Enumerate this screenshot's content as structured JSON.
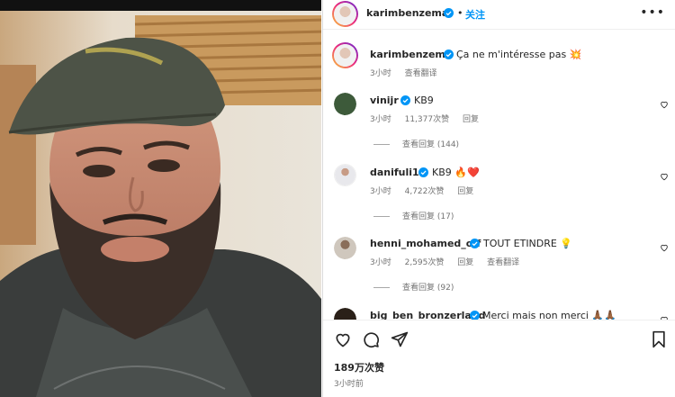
{
  "post": {
    "author": "karimbenzema",
    "follow_label": "关注",
    "more_icon": "more-horizontal-icon",
    "caption_text": "Ça ne m'intéresse pas 💥",
    "caption_time": "3小时",
    "caption_translate": "查看翻译",
    "likes": "189万次赞",
    "time": "3小时前"
  },
  "comments": [
    {
      "user": "vinijr",
      "verified": true,
      "text": "KB9",
      "time": "3小时",
      "likes": "11,377次赞",
      "reply": "回复",
      "replies": "查看回复 (144)",
      "avatar_color": "#3d5a3a"
    },
    {
      "user": "danifuli10",
      "verified": true,
      "text": "KB9 🔥❤️",
      "time": "3小时",
      "likes": "4,722次赞",
      "reply": "回复",
      "replies": "查看回复 (17)",
      "avatar_color": "#e8e8ec"
    },
    {
      "user": "henni_mohamed_off",
      "verified": true,
      "text": "TOUT ETINDRE 💡",
      "time": "3小时",
      "likes": "2,595次赞",
      "reply": "回复",
      "translate": "查看翻译",
      "replies": "查看回复 (92)",
      "avatar_color": "#6b5b4a"
    },
    {
      "user": "big_ben_bronzerland",
      "verified": true,
      "text": "Merci mais non merci 🙏🏾🙏🏾",
      "avatar_color": "#2a2018"
    }
  ],
  "colors": {
    "accent": "#0095f6",
    "verified": "#0095f6",
    "text": "#262626",
    "muted": "#737373"
  },
  "icons": [
    "heart-icon",
    "comment-icon",
    "share-icon",
    "bookmark-icon",
    "verified-badge-icon"
  ]
}
